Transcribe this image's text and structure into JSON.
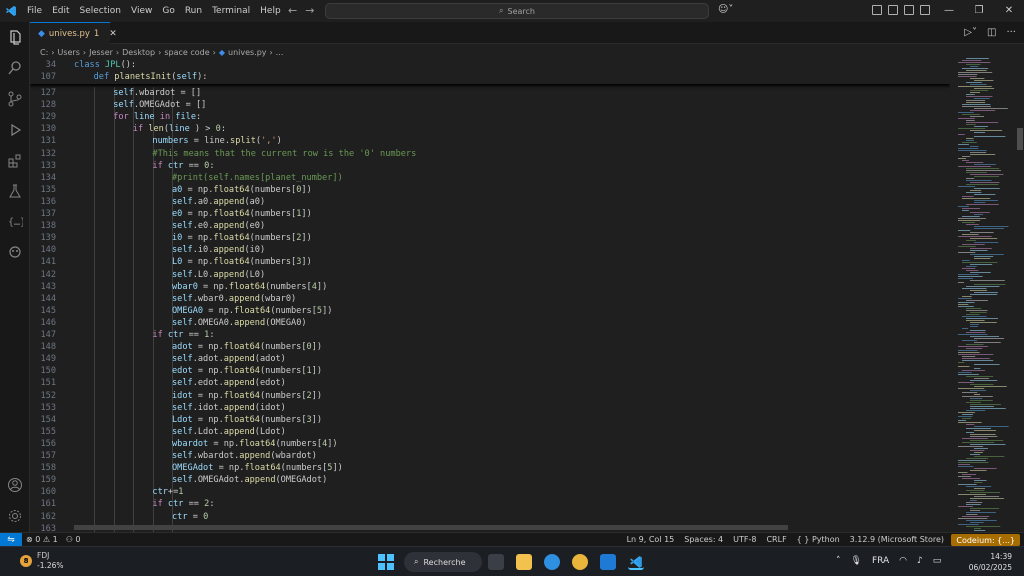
{
  "titlebar": {
    "menu": [
      "File",
      "Edit",
      "Selection",
      "View",
      "Go",
      "Run",
      "Terminal",
      "Help"
    ],
    "search_placeholder": "Search",
    "window_controls": [
      "—",
      "❐",
      "✕"
    ]
  },
  "tab": {
    "label": "unives.py",
    "badge": "1"
  },
  "breadcrumb": [
    "C:",
    "Users",
    "Jesser",
    "Desktop",
    "space code",
    "unives.py",
    "..."
  ],
  "sticky": [
    {
      "num": "34",
      "indent": 0,
      "parts": [
        [
          "kw",
          "class "
        ],
        [
          "cls",
          "JPL"
        ],
        [
          "",
          "():"
        ]
      ]
    },
    {
      "num": "107",
      "indent": 1,
      "parts": [
        [
          "kw",
          "def "
        ],
        [
          "fn",
          "planetsInit"
        ],
        [
          "",
          "("
        ],
        [
          "self",
          "self"
        ],
        [
          "",
          "):"
        ]
      ]
    }
  ],
  "code_lines": [
    {
      "num": "127",
      "indent": 2,
      "parts": [
        [
          "self",
          "self"
        ],
        [
          "",
          ".wbardot = []"
        ]
      ]
    },
    {
      "num": "128",
      "indent": 2,
      "parts": [
        [
          "self",
          "self"
        ],
        [
          "",
          ".OMEGAdot = []"
        ]
      ]
    },
    {
      "num": "129",
      "indent": 2,
      "parts": [
        [
          "ctrl",
          "for "
        ],
        [
          "self",
          "line "
        ],
        [
          "ctrl",
          "in "
        ],
        [
          "self",
          "file"
        ],
        [
          "",
          ":"
        ]
      ]
    },
    {
      "num": "130",
      "indent": 3,
      "parts": [
        [
          "ctrl",
          "if "
        ],
        [
          "fn",
          "len"
        ],
        [
          "",
          "("
        ],
        [
          "self",
          "line"
        ],
        [
          "",
          " ) > "
        ],
        [
          "num",
          "0"
        ],
        [
          "",
          ":"
        ]
      ]
    },
    {
      "num": "131",
      "indent": 4,
      "parts": [
        [
          "self",
          "numbers"
        ],
        [
          "",
          " = line."
        ],
        [
          "fn",
          "split"
        ],
        [
          "",
          "("
        ],
        [
          "str",
          "','"
        ],
        [
          "",
          ")"
        ]
      ]
    },
    {
      "num": "132",
      "indent": 4,
      "parts": [
        [
          "cm",
          "#This means that the current row is the '0' numbers"
        ]
      ]
    },
    {
      "num": "133",
      "indent": 4,
      "parts": [
        [
          "ctrl",
          "if "
        ],
        [
          "self",
          "ctr"
        ],
        [
          "",
          " == "
        ],
        [
          "num",
          "0"
        ],
        [
          "",
          ":"
        ]
      ]
    },
    {
      "num": "134",
      "indent": 5,
      "parts": [
        [
          "cm",
          "#print(self.names[planet_number])"
        ]
      ]
    },
    {
      "num": "135",
      "indent": 5,
      "parts": [
        [
          "self",
          "a0"
        ],
        [
          "",
          " = np."
        ],
        [
          "fn",
          "float64"
        ],
        [
          "",
          "(numbers["
        ],
        [
          "num",
          "0"
        ],
        [
          "",
          "])"
        ]
      ]
    },
    {
      "num": "136",
      "indent": 5,
      "parts": [
        [
          "self",
          "self"
        ],
        [
          "",
          ".a0."
        ],
        [
          "fn",
          "append"
        ],
        [
          "",
          "(a0)"
        ]
      ]
    },
    {
      "num": "137",
      "indent": 5,
      "parts": [
        [
          "self",
          "e0"
        ],
        [
          "",
          " = np."
        ],
        [
          "fn",
          "float64"
        ],
        [
          "",
          "(numbers["
        ],
        [
          "num",
          "1"
        ],
        [
          "",
          "])"
        ]
      ]
    },
    {
      "num": "138",
      "indent": 5,
      "parts": [
        [
          "self",
          "self"
        ],
        [
          "",
          ".e0."
        ],
        [
          "fn",
          "append"
        ],
        [
          "",
          "(e0)"
        ]
      ]
    },
    {
      "num": "139",
      "indent": 5,
      "parts": [
        [
          "self",
          "i0"
        ],
        [
          "",
          " = np."
        ],
        [
          "fn",
          "float64"
        ],
        [
          "",
          "(numbers["
        ],
        [
          "num",
          "2"
        ],
        [
          "",
          "])"
        ]
      ]
    },
    {
      "num": "140",
      "indent": 5,
      "parts": [
        [
          "self",
          "self"
        ],
        [
          "",
          ".i0."
        ],
        [
          "fn",
          "append"
        ],
        [
          "",
          "(i0)"
        ]
      ]
    },
    {
      "num": "141",
      "indent": 5,
      "parts": [
        [
          "self",
          "L0"
        ],
        [
          "",
          " = np."
        ],
        [
          "fn",
          "float64"
        ],
        [
          "",
          "(numbers["
        ],
        [
          "num",
          "3"
        ],
        [
          "",
          "])"
        ]
      ]
    },
    {
      "num": "142",
      "indent": 5,
      "parts": [
        [
          "self",
          "self"
        ],
        [
          "",
          ".L0."
        ],
        [
          "fn",
          "append"
        ],
        [
          "",
          "(L0)"
        ]
      ]
    },
    {
      "num": "143",
      "indent": 5,
      "parts": [
        [
          "self",
          "wbar0"
        ],
        [
          "",
          " = np."
        ],
        [
          "fn",
          "float64"
        ],
        [
          "",
          "(numbers["
        ],
        [
          "num",
          "4"
        ],
        [
          "",
          "])"
        ]
      ]
    },
    {
      "num": "144",
      "indent": 5,
      "parts": [
        [
          "self",
          "self"
        ],
        [
          "",
          ".wbar0."
        ],
        [
          "fn",
          "append"
        ],
        [
          "",
          "(wbar0)"
        ]
      ]
    },
    {
      "num": "145",
      "indent": 5,
      "parts": [
        [
          "self",
          "OMEGA0"
        ],
        [
          "",
          " = np."
        ],
        [
          "fn",
          "float64"
        ],
        [
          "",
          "(numbers["
        ],
        [
          "num",
          "5"
        ],
        [
          "",
          "])"
        ]
      ]
    },
    {
      "num": "146",
      "indent": 5,
      "parts": [
        [
          "self",
          "self"
        ],
        [
          "",
          ".OMEGA0."
        ],
        [
          "fn",
          "append"
        ],
        [
          "",
          "(OMEGA0)"
        ]
      ]
    },
    {
      "num": "147",
      "indent": 4,
      "parts": [
        [
          "ctrl",
          "if "
        ],
        [
          "self",
          "ctr"
        ],
        [
          "",
          " == "
        ],
        [
          "num",
          "1"
        ],
        [
          "",
          ":"
        ]
      ]
    },
    {
      "num": "148",
      "indent": 5,
      "parts": [
        [
          "self",
          "adot"
        ],
        [
          "",
          " = np."
        ],
        [
          "fn",
          "float64"
        ],
        [
          "",
          "(numbers["
        ],
        [
          "num",
          "0"
        ],
        [
          "",
          "])"
        ]
      ]
    },
    {
      "num": "149",
      "indent": 5,
      "parts": [
        [
          "self",
          "self"
        ],
        [
          "",
          ".adot."
        ],
        [
          "fn",
          "append"
        ],
        [
          "",
          "(adot)"
        ]
      ]
    },
    {
      "num": "150",
      "indent": 5,
      "parts": [
        [
          "self",
          "edot"
        ],
        [
          "",
          " = np."
        ],
        [
          "fn",
          "float64"
        ],
        [
          "",
          "(numbers["
        ],
        [
          "num",
          "1"
        ],
        [
          "",
          "])"
        ]
      ]
    },
    {
      "num": "151",
      "indent": 5,
      "parts": [
        [
          "self",
          "self"
        ],
        [
          "",
          ".edot."
        ],
        [
          "fn",
          "append"
        ],
        [
          "",
          "(edot)"
        ]
      ]
    },
    {
      "num": "152",
      "indent": 5,
      "parts": [
        [
          "self",
          "idot"
        ],
        [
          "",
          " = np."
        ],
        [
          "fn",
          "float64"
        ],
        [
          "",
          "(numbers["
        ],
        [
          "num",
          "2"
        ],
        [
          "",
          "])"
        ]
      ]
    },
    {
      "num": "153",
      "indent": 5,
      "parts": [
        [
          "self",
          "self"
        ],
        [
          "",
          ".idot."
        ],
        [
          "fn",
          "append"
        ],
        [
          "",
          "(idot)"
        ]
      ]
    },
    {
      "num": "154",
      "indent": 5,
      "parts": [
        [
          "self",
          "Ldot"
        ],
        [
          "",
          " = np."
        ],
        [
          "fn",
          "float64"
        ],
        [
          "",
          "(numbers["
        ],
        [
          "num",
          "3"
        ],
        [
          "",
          "])"
        ]
      ]
    },
    {
      "num": "155",
      "indent": 5,
      "parts": [
        [
          "self",
          "self"
        ],
        [
          "",
          ".Ldot."
        ],
        [
          "fn",
          "append"
        ],
        [
          "",
          "(Ldot)"
        ]
      ]
    },
    {
      "num": "156",
      "indent": 5,
      "parts": [
        [
          "self",
          "wbardot"
        ],
        [
          "",
          " = np."
        ],
        [
          "fn",
          "float64"
        ],
        [
          "",
          "(numbers["
        ],
        [
          "num",
          "4"
        ],
        [
          "",
          "])"
        ]
      ]
    },
    {
      "num": "157",
      "indent": 5,
      "parts": [
        [
          "self",
          "self"
        ],
        [
          "",
          ".wbardot."
        ],
        [
          "fn",
          "append"
        ],
        [
          "",
          "(wbardot)"
        ]
      ]
    },
    {
      "num": "158",
      "indent": 5,
      "parts": [
        [
          "self",
          "OMEGAdot"
        ],
        [
          "",
          " = np."
        ],
        [
          "fn",
          "float64"
        ],
        [
          "",
          "(numbers["
        ],
        [
          "num",
          "5"
        ],
        [
          "",
          "])"
        ]
      ]
    },
    {
      "num": "159",
      "indent": 5,
      "parts": [
        [
          "self",
          "self"
        ],
        [
          "",
          ".OMEGAdot."
        ],
        [
          "fn",
          "append"
        ],
        [
          "",
          "(OMEGAdot)"
        ]
      ]
    },
    {
      "num": "160",
      "indent": 4,
      "parts": [
        [
          "self",
          "ctr"
        ],
        [
          "",
          "+="
        ],
        [
          "num",
          "1"
        ]
      ]
    },
    {
      "num": "161",
      "indent": 4,
      "parts": [
        [
          "ctrl",
          "if "
        ],
        [
          "self",
          "ctr"
        ],
        [
          "",
          " == "
        ],
        [
          "num",
          "2"
        ],
        [
          "",
          ":"
        ]
      ]
    },
    {
      "num": "162",
      "indent": 5,
      "parts": [
        [
          "self",
          "ctr"
        ],
        [
          "",
          " = "
        ],
        [
          "num",
          "0"
        ]
      ]
    },
    {
      "num": "163",
      "indent": 4,
      "parts": []
    }
  ],
  "statusbar": {
    "errors": "0",
    "warnings": "1",
    "ports": "0",
    "position": "Ln 9, Col 15",
    "spaces": "Spaces: 4",
    "encoding": "UTF-8",
    "eol": "CRLF",
    "language": "{ } Python",
    "interpreter": "3.12.9 (Microsoft Store)",
    "codeium": "Codeium: {...}"
  },
  "taskbar": {
    "weather_badge": "8",
    "weather_name": "FDJ",
    "weather_change": "-1.26%",
    "search": "Recherche",
    "language": "FRA",
    "time": "14:39",
    "date": "06/02/2025"
  },
  "icons": {
    "explorer": "files-icon",
    "search": "search-icon",
    "scm": "source-control-icon",
    "run": "run-debug-icon",
    "extensions": "extensions-icon"
  }
}
